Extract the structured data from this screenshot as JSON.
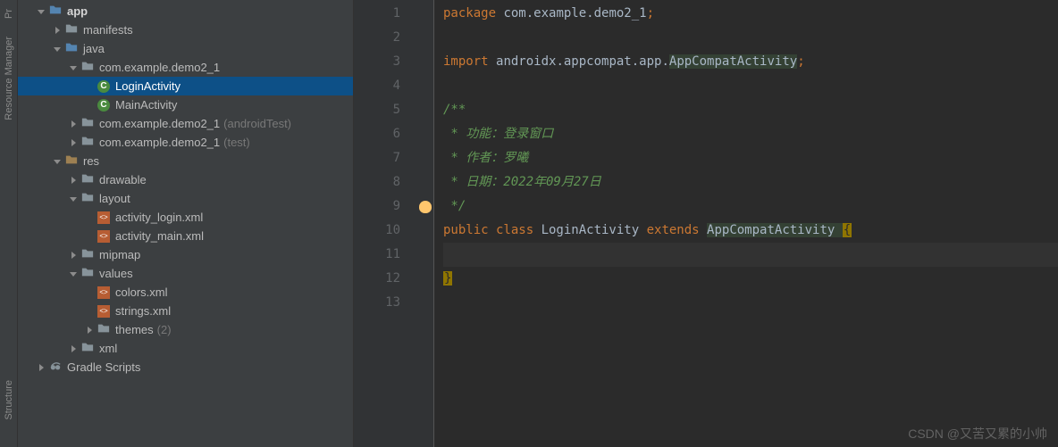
{
  "rail": {
    "top": "Resource Manager",
    "bottom": "Structure",
    "pr": "Pr"
  },
  "tree": [
    {
      "depth": 0,
      "arrow": "down",
      "icon": "module",
      "label": "app",
      "bold": true
    },
    {
      "depth": 1,
      "arrow": "right",
      "icon": "folder",
      "label": "manifests"
    },
    {
      "depth": 1,
      "arrow": "down",
      "icon": "folder-open",
      "label": "java"
    },
    {
      "depth": 2,
      "arrow": "down",
      "icon": "package",
      "label": "com.example.demo2_1"
    },
    {
      "depth": 3,
      "arrow": "",
      "icon": "class",
      "label": "LoginActivity",
      "selected": true
    },
    {
      "depth": 3,
      "arrow": "",
      "icon": "class",
      "label": "MainActivity"
    },
    {
      "depth": 2,
      "arrow": "right",
      "icon": "package",
      "label": "com.example.demo2_1",
      "suffix": "(androidTest)"
    },
    {
      "depth": 2,
      "arrow": "right",
      "icon": "package",
      "label": "com.example.demo2_1",
      "suffix": "(test)"
    },
    {
      "depth": 1,
      "arrow": "down",
      "icon": "res",
      "label": "res"
    },
    {
      "depth": 2,
      "arrow": "right",
      "icon": "folder",
      "label": "drawable"
    },
    {
      "depth": 2,
      "arrow": "down",
      "icon": "folder",
      "label": "layout"
    },
    {
      "depth": 3,
      "arrow": "",
      "icon": "xml",
      "label": "activity_login.xml"
    },
    {
      "depth": 3,
      "arrow": "",
      "icon": "xml",
      "label": "activity_main.xml"
    },
    {
      "depth": 2,
      "arrow": "right",
      "icon": "folder",
      "label": "mipmap"
    },
    {
      "depth": 2,
      "arrow": "down",
      "icon": "folder",
      "label": "values"
    },
    {
      "depth": 3,
      "arrow": "",
      "icon": "xml",
      "label": "colors.xml"
    },
    {
      "depth": 3,
      "arrow": "",
      "icon": "xml",
      "label": "strings.xml"
    },
    {
      "depth": 3,
      "arrow": "right",
      "icon": "folder",
      "label": "themes",
      "suffix": "(2)"
    },
    {
      "depth": 2,
      "arrow": "right",
      "icon": "folder",
      "label": "xml"
    },
    {
      "depth": 0,
      "arrow": "right",
      "icon": "gradle",
      "label": "Gradle Scripts"
    }
  ],
  "code": {
    "lines": [
      {
        "n": 1,
        "tokens": [
          [
            "package ",
            "k-keyword"
          ],
          [
            "com.example.demo2_1",
            "k-default"
          ],
          [
            ";",
            "k-semi"
          ]
        ]
      },
      {
        "n": 2,
        "tokens": []
      },
      {
        "n": 3,
        "tokens": [
          [
            "import ",
            "k-keyword"
          ],
          [
            "androidx.appcompat.app.",
            "k-default"
          ],
          [
            "AppCompatActivity",
            "k-default hl"
          ],
          [
            ";",
            "k-semi"
          ]
        ]
      },
      {
        "n": 4,
        "tokens": []
      },
      {
        "n": 5,
        "tokens": [
          [
            "/**",
            "k-docgreen"
          ]
        ]
      },
      {
        "n": 6,
        "tokens": [
          [
            " * 功能：登录窗口",
            "k-docgreen"
          ]
        ]
      },
      {
        "n": 7,
        "tokens": [
          [
            " * 作者：罗曦",
            "k-docgreen"
          ]
        ]
      },
      {
        "n": 8,
        "tokens": [
          [
            " * 日期：2022年09月27日",
            "k-docgreen"
          ]
        ]
      },
      {
        "n": 9,
        "tokens": [
          [
            " */",
            "k-docgreen"
          ]
        ],
        "bulb": true
      },
      {
        "n": 10,
        "tokens": [
          [
            "public class ",
            "k-keyword"
          ],
          [
            "LoginActivity ",
            "k-default"
          ],
          [
            "extends ",
            "k-keyword"
          ],
          [
            "AppCompatActivity ",
            "k-default hl"
          ],
          [
            "{",
            "k-brace yellow-bg"
          ]
        ]
      },
      {
        "n": 11,
        "tokens": [],
        "caret": true
      },
      {
        "n": 12,
        "tokens": [
          [
            "}",
            "k-brace yellow-bg"
          ]
        ]
      },
      {
        "n": 13,
        "tokens": []
      }
    ]
  },
  "watermark": "CSDN @又苦又累的小帅"
}
